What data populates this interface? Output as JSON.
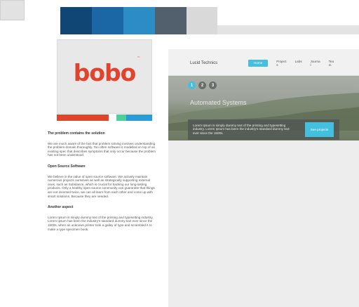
{
  "colors": {
    "swatches": [
      "#0f4675",
      "#1b67a6",
      "#2c8cc6",
      "#52606e",
      "#d9d9d9"
    ],
    "accent": "#43c0e0",
    "logo_red": "#e2432c",
    "color_bar": [
      "#e2432c",
      "#ffffff",
      "#4ecf9a",
      "#2a9ad8"
    ]
  },
  "logo": {
    "text": "bobo",
    "tm": "™"
  },
  "article": {
    "sections": [
      {
        "heading": "The problem contains the solution",
        "body": "We are much aware of the fact that problem solving involves understanding the problem domain thoroughly. Too often software is modelled on top of an existing spec that describes symptoms that only occur because the problem has not been understood."
      },
      {
        "heading": "Open Source Software",
        "body": "We believe in the value of open source software. We actively maintain numerous projects ourselves as well as strategically supporting external ones, such as Substance, which is crucial for backing our long-lasting products. Only a healthy open source community can guarantee that things are not invented twice, we can all learn from each other and come up with smart solutions. Because they are needed."
      },
      {
        "heading": "Another aspect",
        "body": "Lorem Ipsum is simply dummy text of the printing and typesetting industry. Lorem Ipsum has been the industry's standard dummy text ever since the 1500s, when an unknown printer took a galley of type and scrambled it to make a type specimen book."
      }
    ]
  },
  "site": {
    "brand": "Lucid Technics",
    "nav": {
      "home": "Home",
      "project_top": "Project",
      "project_bottom": "s",
      "labs": "Labs",
      "journal_top": "Journa",
      "journal_bottom": "l",
      "team_top": "Tea",
      "team_bottom": "m"
    },
    "hero": {
      "slides": [
        "1",
        "2",
        "3"
      ],
      "title": "Automated Systems",
      "bar_text": "Lorem Ipsum is simply dummy text of the printing and typesetting industry. Lorem Ipsum has been the industry's standard dummy text ever since the 1500s.",
      "button": "See projects"
    }
  }
}
